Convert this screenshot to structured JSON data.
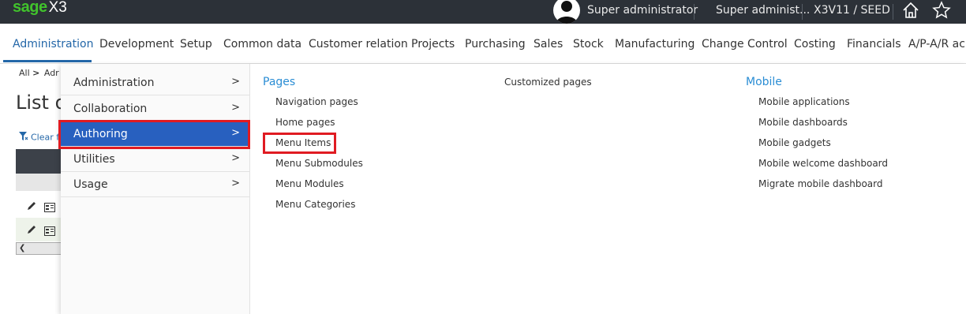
{
  "topbar": {
    "logo_brand": "sage",
    "logo_product": "X3",
    "user_name": "Super administrator",
    "role": "Super administ...",
    "endpoint": "X3V11 / SEED",
    "icons": [
      "avatar-icon",
      "home-icon",
      "star-icon"
    ]
  },
  "main_menu": {
    "items": [
      "Administration",
      "Development",
      "Setup",
      "Common data",
      "Customer relation",
      "Projects",
      "Purchasing",
      "Sales",
      "Stock",
      "Manufacturing",
      "Change Control",
      "Costing",
      "Financials",
      "A/P-A/R ac"
    ],
    "active": "Administration",
    "accent_color": "#2467a8"
  },
  "background_page": {
    "breadcrumb_all": "All",
    "breadcrumb_sep": ">",
    "breadcrumb_next": "Adr",
    "title": "List o",
    "clear_filter": "Clear fi"
  },
  "mega_menu": {
    "categories": [
      {
        "label": "Administration",
        "arrow": ">"
      },
      {
        "label": "Collaboration",
        "arrow": ">"
      },
      {
        "label": "Authoring",
        "arrow": ">"
      },
      {
        "label": "Utilities",
        "arrow": ">"
      },
      {
        "label": "Usage",
        "arrow": ">"
      }
    ],
    "selected_category": "Authoring",
    "selected_color": "#2860bf",
    "highlight_color": "#e01b22",
    "groups": {
      "pages": {
        "title": "Pages",
        "links": [
          "Navigation pages",
          "Home pages",
          "Menu Items",
          "Menu Submodules",
          "Menu Modules",
          "Menu Categories"
        ]
      },
      "customized": {
        "title": "Customized pages"
      },
      "mobile": {
        "title": "Mobile",
        "links": [
          "Mobile applications",
          "Mobile dashboards",
          "Mobile gadgets",
          "Mobile welcome dashboard",
          "Migrate mobile dashboard"
        ]
      }
    },
    "highlighted_link": "Menu Items"
  }
}
